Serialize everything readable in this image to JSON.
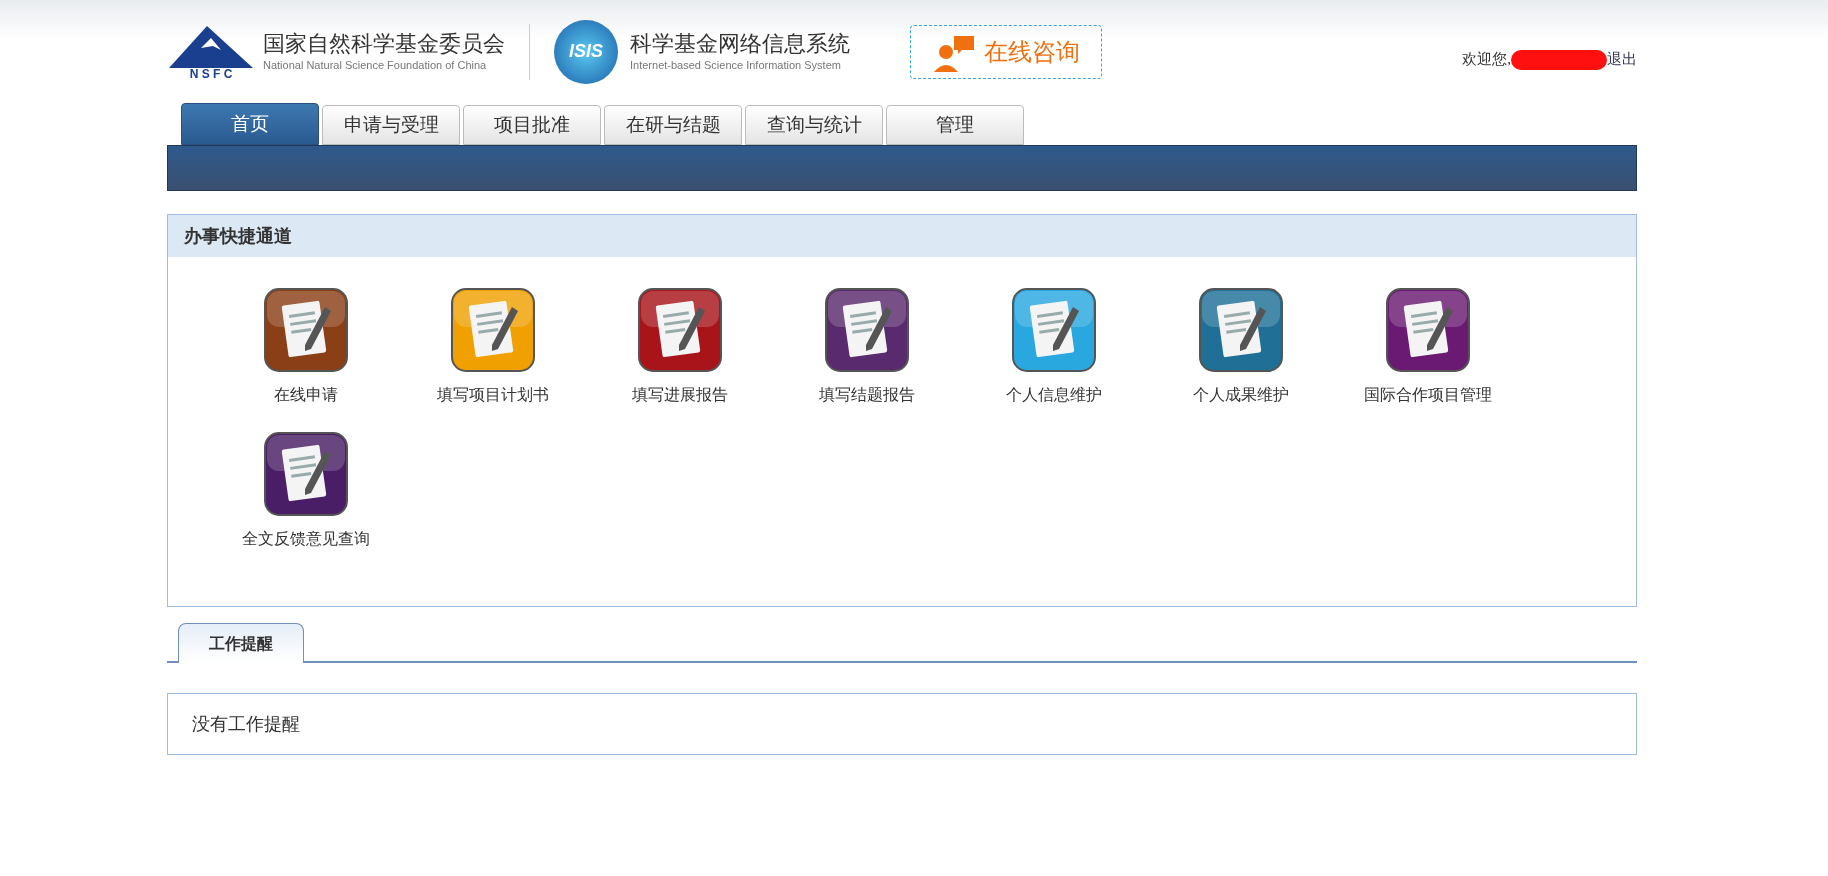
{
  "header": {
    "org_name": "国家自然科学基金委员会",
    "org_name_en": "National Natural Science Foundation of China",
    "org_abbr": "N S F C",
    "system_logo": "ISIS",
    "system_name": "科学基金网络信息系统",
    "system_name_en": "Internet-based Science Information System",
    "consult_button": "在线咨询",
    "welcome": "欢迎您,",
    "logout": "退出"
  },
  "nav_tabs": [
    {
      "label": "首页",
      "selected": true
    },
    {
      "label": "申请与受理",
      "selected": false
    },
    {
      "label": "项目批准",
      "selected": false
    },
    {
      "label": "在研与结题",
      "selected": false
    },
    {
      "label": "查询与统计",
      "selected": false
    },
    {
      "label": "管理",
      "selected": false
    }
  ],
  "shortcuts": {
    "title": "办事快捷通道",
    "items": [
      {
        "label": "在线申请",
        "color": "#8a3f17"
      },
      {
        "label": "填写项目计划书",
        "color": "#f0a000"
      },
      {
        "label": "填写进展报告",
        "color": "#a8141a"
      },
      {
        "label": "填写结题报告",
        "color": "#5a2a6e"
      },
      {
        "label": "个人信息维护",
        "color": "#29a8e0"
      },
      {
        "label": "个人成果维护",
        "color": "#1f6f96"
      },
      {
        "label": "国际合作项目管理",
        "color": "#6a1a72"
      },
      {
        "label": "全文反馈意见查询",
        "color": "#4a1e66"
      }
    ]
  },
  "reminder_tabs": [
    {
      "label": "工作提醒",
      "selected": true
    }
  ],
  "reminder_message": "没有工作提醒"
}
